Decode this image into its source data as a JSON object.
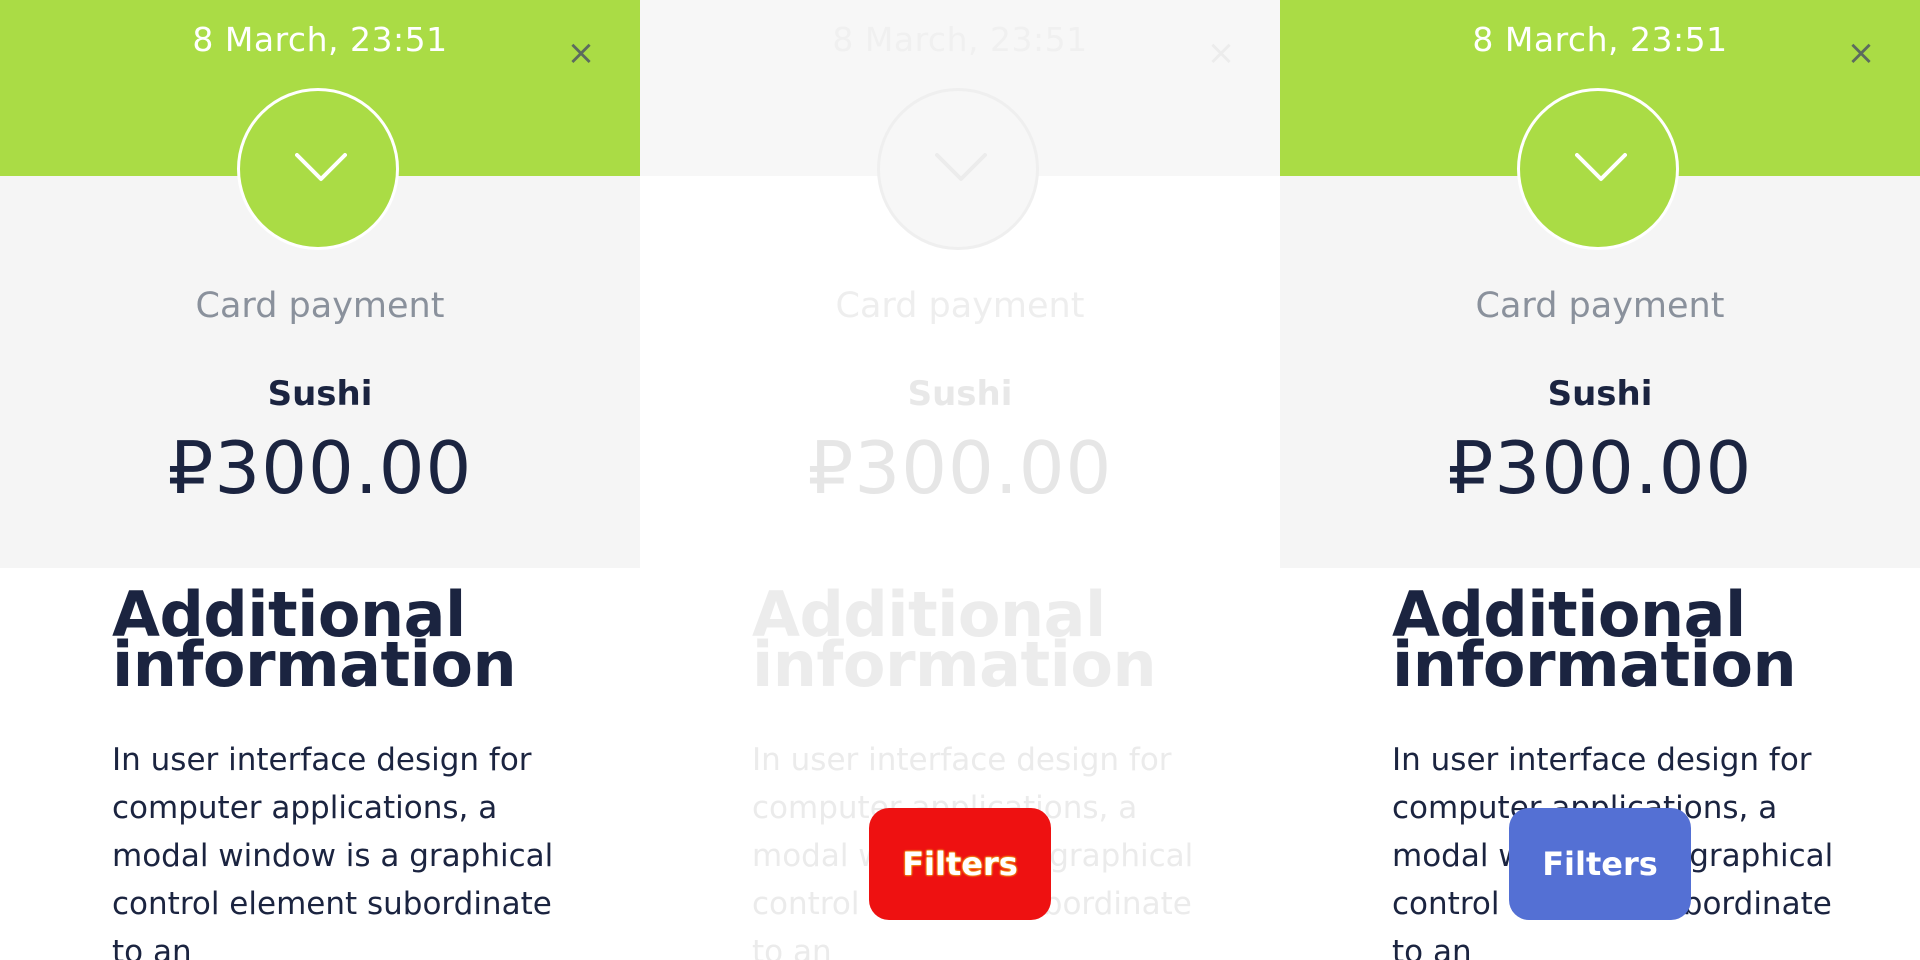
{
  "panels": [
    {
      "date": "8 March, 23:51",
      "close_glyph": "×",
      "status_icon": "chevron-down-icon",
      "payment_method": "Card payment",
      "merchant": "Sushi",
      "amount": "₽300.00",
      "info_title": "Additional information",
      "info_body": "In user interface design for computer applications, a modal window is a graphical control element subordinate to an"
    },
    {
      "date": "8 March, 23:51",
      "close_glyph": "×",
      "status_icon": "chevron-down-icon",
      "payment_method": "Card payment",
      "merchant": "Sushi",
      "amount": "₽300.00",
      "info_title": "Additional information",
      "info_body": "In user interface design for computer applications, a modal window is a graphical control element subordinate to an"
    },
    {
      "date": "8 March, 23:51",
      "close_glyph": "×",
      "status_icon": "chevron-down-icon",
      "payment_method": "Card payment",
      "merchant": "Sushi",
      "amount": "₽300.00",
      "info_title": "Additional information",
      "info_body": "In user interface design for computer applications, a modal window is a graphical control element subordinate to an"
    }
  ],
  "filters_buttons": [
    {
      "label": "Filters",
      "color": "#ee1111"
    },
    {
      "label": "Filters",
      "color": "#5470d4"
    }
  ],
  "colors": {
    "accent_green": "#aadc45",
    "receipt_bg": "#f5f5f5",
    "text_dark": "#1b2440",
    "text_muted": "#8a919c",
    "filters_blue": "#5470d4",
    "filters_red": "#ee1111"
  }
}
